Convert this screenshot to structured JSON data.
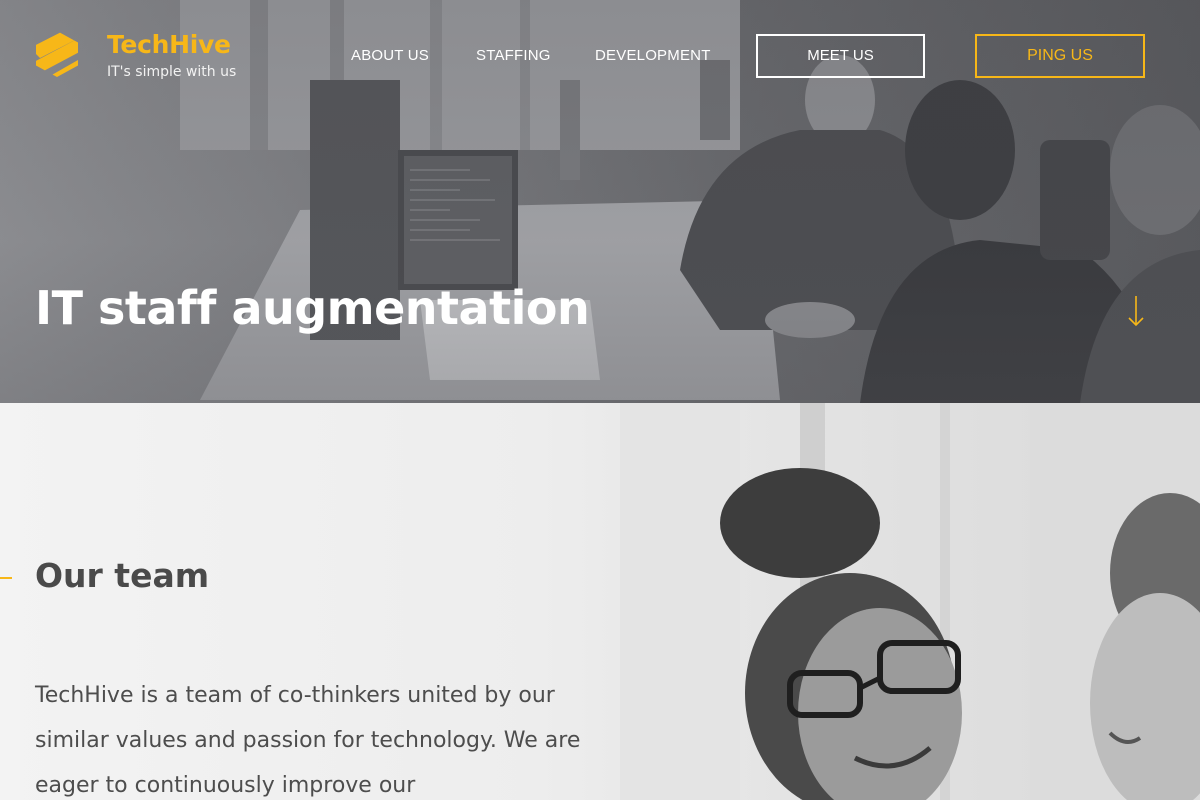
{
  "brand": {
    "name": "TechHive",
    "tagline": "IT's simple with us",
    "accent_color": "#f7b718",
    "logo_icon": "striped-hexagon-logo"
  },
  "nav": {
    "items": [
      {
        "label": "ABOUT US"
      },
      {
        "label": "STAFFING"
      },
      {
        "label": "DEVELOPMENT"
      }
    ],
    "meet_button": "MEET US",
    "ping_button": "PING US"
  },
  "hero": {
    "title": "IT staff augmentation",
    "scroll_icon": "arrow-down-icon",
    "background": "grayscale office photo"
  },
  "team": {
    "title": "Our team",
    "body": "TechHive is a team of co-thinkers united by our similar values and passion for technology. We are eager to continuously improve our"
  }
}
